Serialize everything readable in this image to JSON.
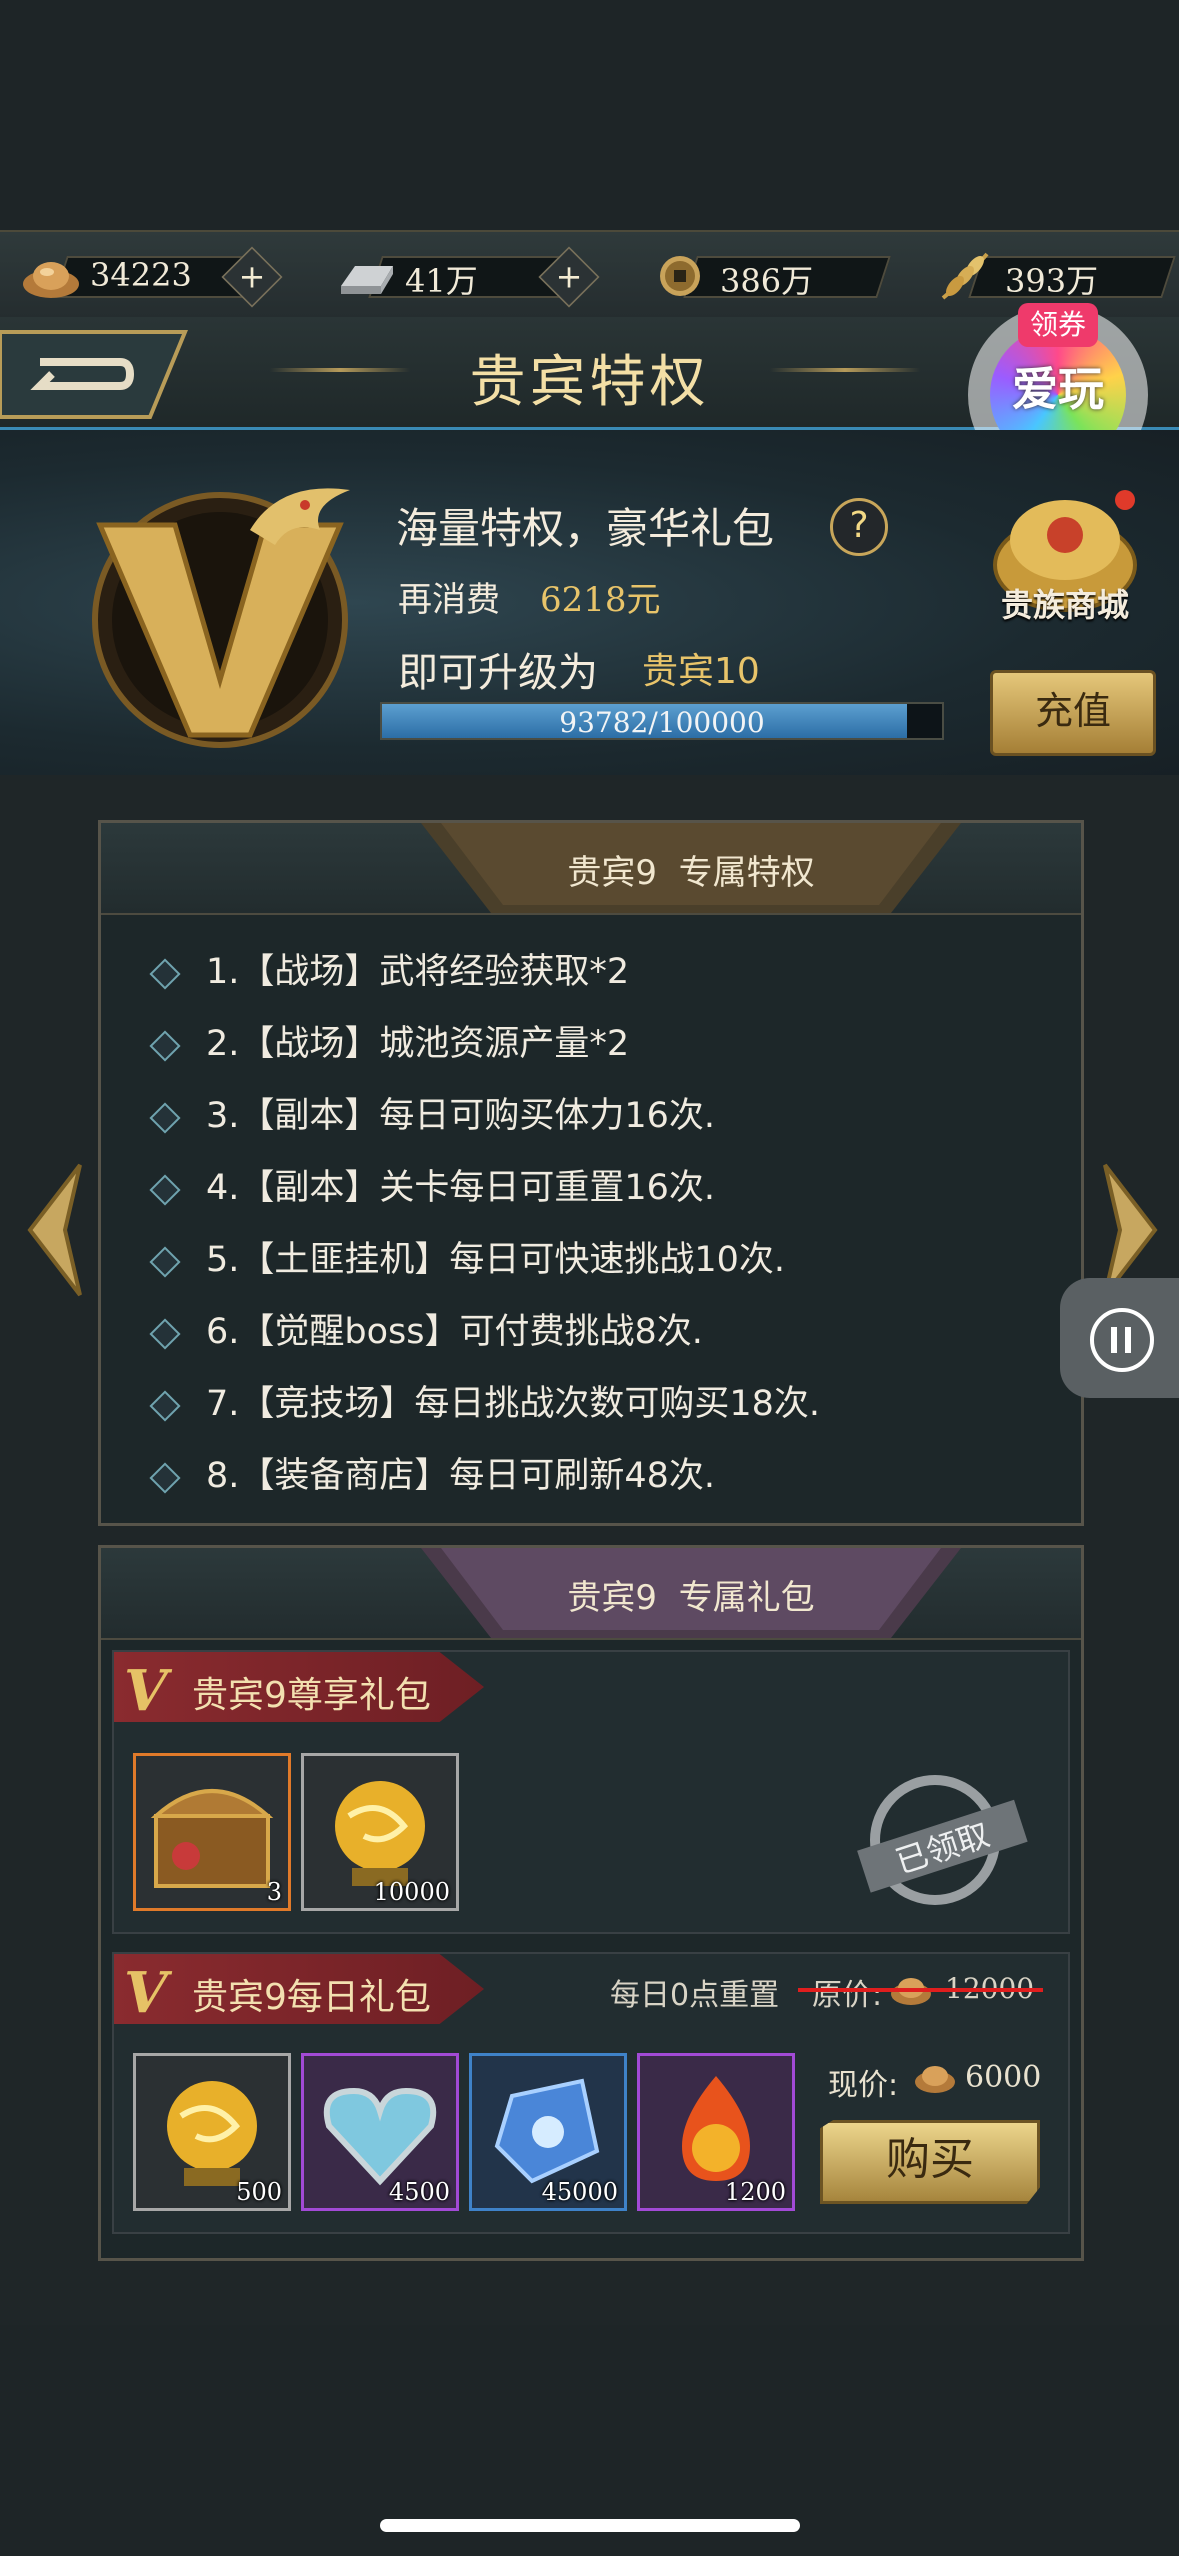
{
  "resources": [
    {
      "icon": "gold-ingot-icon",
      "value": "34223",
      "has_plus": true
    },
    {
      "icon": "silver-bar-icon",
      "value": "41万",
      "has_plus": true
    },
    {
      "icon": "copper-coin-icon",
      "value": "386万",
      "has_plus": false
    },
    {
      "icon": "grain-icon",
      "value": "393万",
      "has_plus": false
    }
  ],
  "title": "贵宾特权",
  "promo": {
    "tag": "领券",
    "text": "爱玩"
  },
  "header": {
    "line1": "海量特权，豪华礼包",
    "help": "?",
    "spend_label": "再消费",
    "spend_value": "6218元",
    "upgrade_label": "即可升级为",
    "upgrade_value": "贵宾10",
    "progress_text": "93782/100000",
    "progress_ratio": 0.9378,
    "shop_label": "贵族商城",
    "recharge_label": "充值"
  },
  "privileges_panel": {
    "title_level": "贵宾9",
    "title_rest": "专属特权",
    "items": [
      "1.【战场】武将经验获取*2",
      "2.【战场】城池资源产量*2",
      "3.【副本】每日可购买体力16次.",
      "4.【副本】关卡每日可重置16次.",
      "5.【土匪挂机】每日可快速挑战10次.",
      "6.【觉醒boss】可付费挑战8次.",
      "7.【竞技场】每日挑战次数可购买18次.",
      "8.【装备商店】每日可刷新48次."
    ]
  },
  "gifts_panel": {
    "title_level": "贵宾9",
    "title_rest": "专属礼包",
    "premium": {
      "label": "贵宾9尊享礼包",
      "items": [
        {
          "icon": "treasure-chest-icon",
          "count": "3",
          "border": "#e07a2a"
        },
        {
          "icon": "golden-orb-icon",
          "count": "10000",
          "border": "#a7a7a7"
        }
      ],
      "claimed_stamp": "已领取"
    },
    "daily": {
      "label": "贵宾9每日礼包",
      "reset_note": "每日0点重置",
      "original_price_label": "原价:",
      "original_price": "12000",
      "current_price_label": "现价:",
      "current_price": "6000",
      "buy_label": "购买",
      "items": [
        {
          "icon": "golden-orb-icon",
          "count": "500",
          "border": "#a7a7a7"
        },
        {
          "icon": "crystal-heart-icon",
          "count": "4500",
          "border": "#a24ad6"
        },
        {
          "icon": "blue-crystal-icon",
          "count": "45000",
          "border": "#3f82c8"
        },
        {
          "icon": "fire-orb-icon",
          "count": "1200",
          "border": "#a24ad6"
        }
      ]
    }
  },
  "colors": {
    "accent_gold": "#e8c46a",
    "progress_blue": "#3b7fb8",
    "tag_red": "#8a2b2f"
  }
}
